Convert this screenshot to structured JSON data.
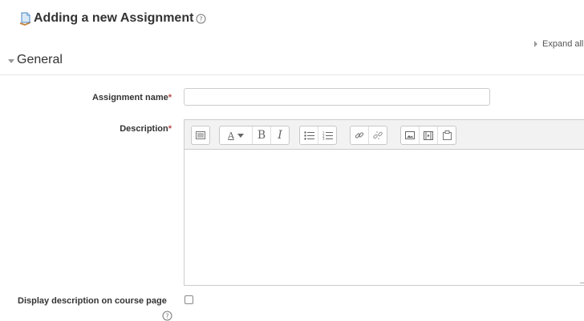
{
  "page": {
    "title": "Adding a new Assignment",
    "icons": {
      "page": "assignment-page-icon",
      "help": "help-icon"
    }
  },
  "controls": {
    "expand_all": "Expand all"
  },
  "section": {
    "legend": "General"
  },
  "form": {
    "assignment_name": {
      "label": "Assignment name",
      "required_mark": "*",
      "value": ""
    },
    "description": {
      "label": "Description",
      "required_mark": "*",
      "toolbar": {
        "groups": [
          [
            "show-more-buttons-icon"
          ],
          [
            "font-style-icon",
            "bold-icon",
            "italic-icon"
          ],
          [
            "unordered-list-icon",
            "ordered-list-icon"
          ],
          [
            "link-icon",
            "unlink-icon"
          ],
          [
            "image-icon",
            "media-icon",
            "manage-files-icon"
          ]
        ],
        "bold_glyph": "B",
        "italic_glyph": "I",
        "font_glyph": "A"
      },
      "value": ""
    },
    "display_on_course_page": {
      "label": "Display description on course page",
      "checked": false
    }
  },
  "colors": {
    "required": "#b94a48",
    "toolbar_bg": "#f2f2f2",
    "border": "#cccccc"
  }
}
